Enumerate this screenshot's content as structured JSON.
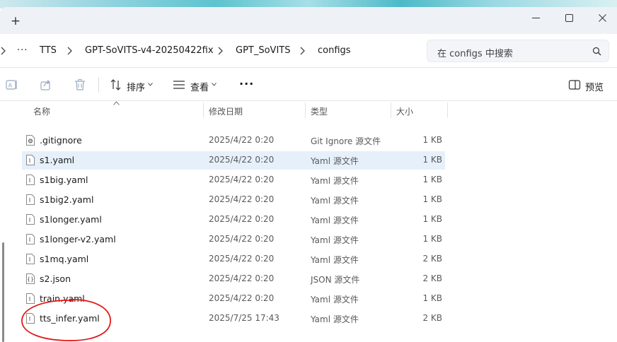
{
  "titlebar": {
    "new_tab": "+",
    "minimize": "minimize",
    "maximize": "maximize",
    "close": "close"
  },
  "address": {
    "more": "···",
    "breadcrumbs": [
      "TTS",
      "GPT-SoVITS-v4-20250422fix",
      "GPT_SoVITS",
      "configs"
    ],
    "search_placeholder": "在 configs 中搜索"
  },
  "toolbar": {
    "sort_label": "排序",
    "view_label": "查看",
    "more_label": "···",
    "preview_label": "预览"
  },
  "columns": {
    "name": "名称",
    "date": "修改日期",
    "type": "类型",
    "size": "大小"
  },
  "files": [
    {
      "name": ".gitignore",
      "date": "2025/4/22 0:20",
      "type": "Git Ignore 源文件",
      "size": "1 KB",
      "icon": "gitignore-file-icon"
    },
    {
      "name": "s1.yaml",
      "date": "2025/4/22 0:20",
      "type": "Yaml 源文件",
      "size": "1 KB",
      "icon": "yaml-file-icon"
    },
    {
      "name": "s1big.yaml",
      "date": "2025/4/22 0:20",
      "type": "Yaml 源文件",
      "size": "1 KB",
      "icon": "yaml-file-icon"
    },
    {
      "name": "s1big2.yaml",
      "date": "2025/4/22 0:20",
      "type": "Yaml 源文件",
      "size": "1 KB",
      "icon": "yaml-file-icon"
    },
    {
      "name": "s1longer.yaml",
      "date": "2025/4/22 0:20",
      "type": "Yaml 源文件",
      "size": "1 KB",
      "icon": "yaml-file-icon"
    },
    {
      "name": "s1longer-v2.yaml",
      "date": "2025/4/22 0:20",
      "type": "Yaml 源文件",
      "size": "1 KB",
      "icon": "yaml-file-icon"
    },
    {
      "name": "s1mq.yaml",
      "date": "2025/4/22 0:20",
      "type": "Yaml 源文件",
      "size": "2 KB",
      "icon": "yaml-file-icon"
    },
    {
      "name": "s2.json",
      "date": "2025/4/22 0:20",
      "type": "JSON 源文件",
      "size": "2 KB",
      "icon": "json-file-icon"
    },
    {
      "name": "train.yaml",
      "date": "2025/4/22 0:20",
      "type": "Yaml 源文件",
      "size": "1 KB",
      "icon": "yaml-file-icon"
    },
    {
      "name": "tts_infer.yaml",
      "date": "2025/7/25 17:43",
      "type": "Yaml 源文件",
      "size": "2 KB",
      "icon": "yaml-file-icon"
    }
  ],
  "selected_file": "s1.yaml",
  "colors": {
    "selection": "#e6f0fb",
    "annotation": "#e01b1b",
    "titlebar": "#eef1f6"
  }
}
